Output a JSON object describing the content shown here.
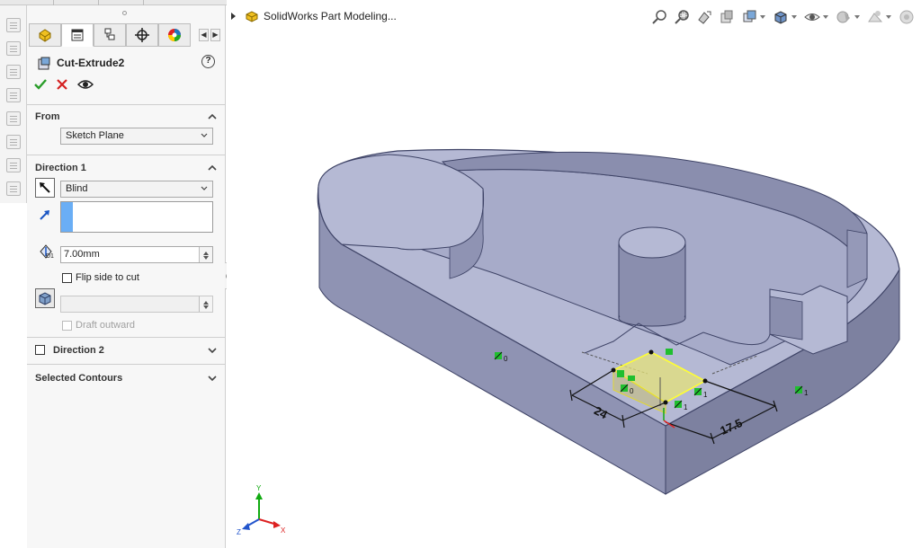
{
  "panel": {
    "tabs": [
      {
        "name": "featuremanager-tab",
        "icon": "part-icon"
      },
      {
        "name": "propertymanager-tab",
        "icon": "property-manager-icon"
      },
      {
        "name": "configurationmanager-tab",
        "icon": "configuration-icon"
      },
      {
        "name": "dimxpert-tab",
        "icon": "target-icon"
      },
      {
        "name": "display-manager-tab",
        "icon": "appearance-icon"
      }
    ],
    "feature_title": "Cut-Extrude2",
    "help_glyph": "?",
    "from_section": {
      "title": "From",
      "selected": "Sketch Plane"
    },
    "direction1": {
      "title": "Direction 1",
      "end_condition": "Blind",
      "depth": "7.00mm",
      "depth_icon_label": "D1",
      "flip_label": "Flip side to cut",
      "draft_outward_label": "Draft outward"
    },
    "direction2": {
      "title": "Direction 2"
    },
    "selected_contours": {
      "title": "Selected Contours"
    }
  },
  "viewport": {
    "tree_item": "SolidWorks Part Modeling...",
    "dims": {
      "d1": "24",
      "d2": "17.5"
    },
    "relation_labels": [
      "0",
      "0",
      "1",
      "1",
      "1"
    ],
    "triad": {
      "x": "X",
      "y": "Y",
      "z": "Z"
    }
  },
  "colors": {
    "part_top": "#b5b9d4",
    "part_side": "#8f93b3",
    "part_front": "#7d81a0",
    "edge": "#3e4366",
    "sketch_highlight": "#ffff66",
    "relation_green": "#1fbf2f",
    "accept_green": "#2a9d2a",
    "cancel_red": "#d42020",
    "selection_blue": "#6aaef5"
  }
}
